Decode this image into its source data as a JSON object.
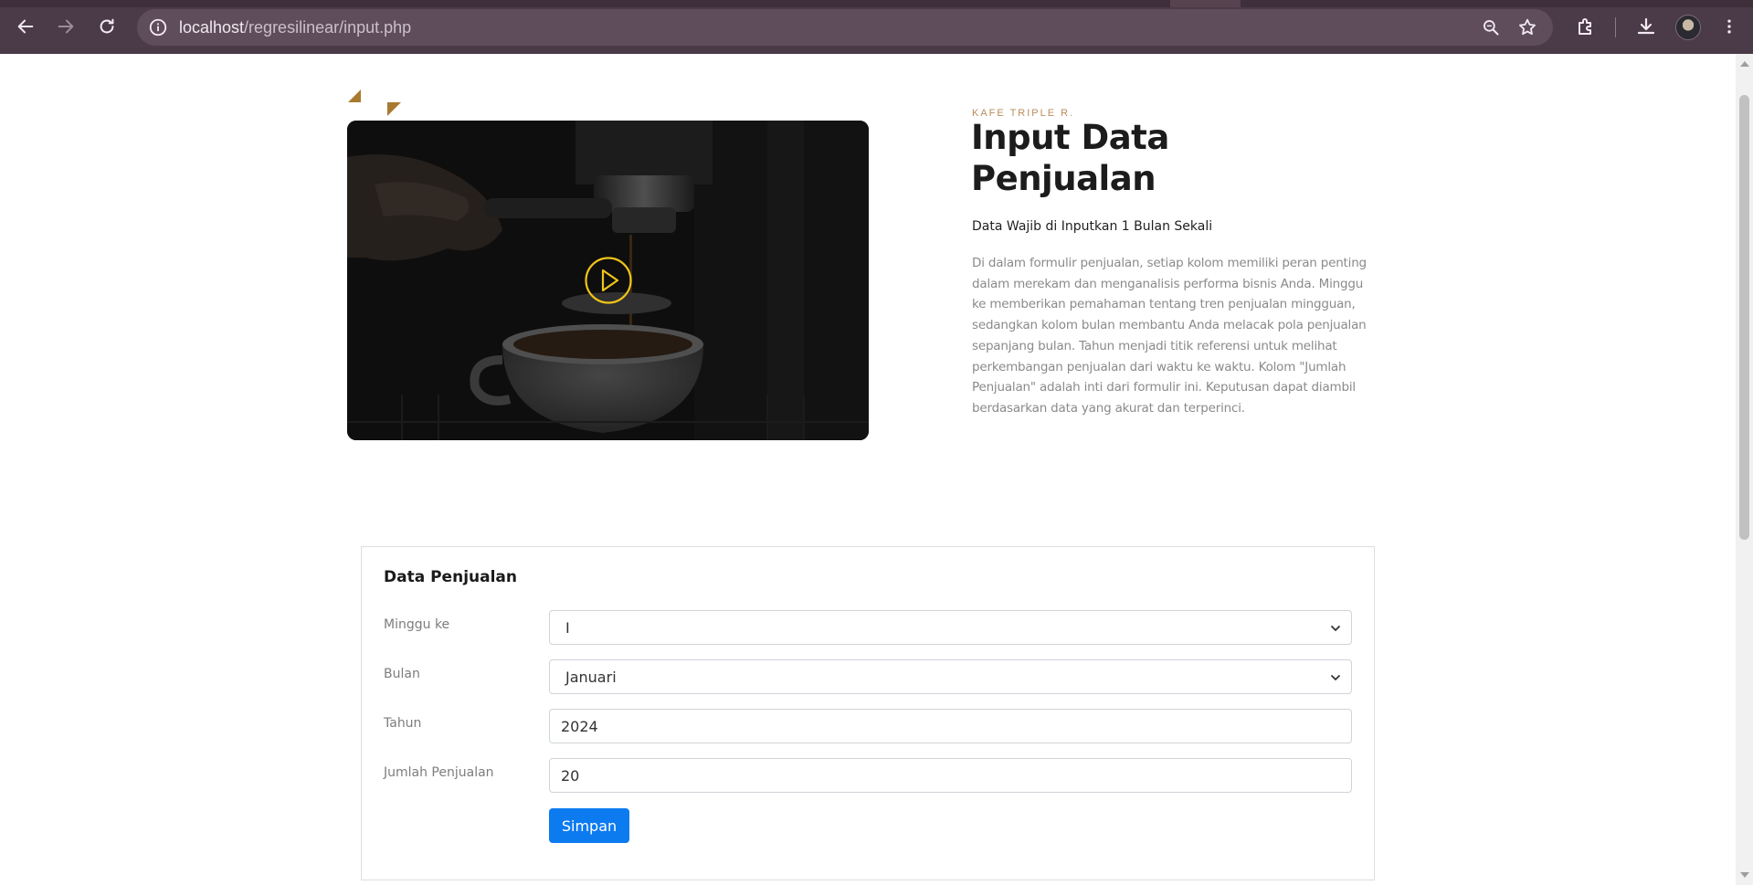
{
  "browser": {
    "url_host": "localhost",
    "url_path": "/regresilinear/input.php"
  },
  "hero": {
    "eyebrow": "KAFE TRIPLE R.",
    "title": "Input Data Penjualan",
    "subtitle": "Data Wajib di Inputkan 1 Bulan Sekali",
    "description": "Di dalam formulir penjualan, setiap kolom memiliki peran penting dalam merekam dan menganalisis performa bisnis Anda. Minggu ke memberikan pemahaman tentang tren penjualan mingguan, sedangkan kolom bulan membantu Anda melacak pola penjualan sepanjang bulan. Tahun menjadi titik referensi untuk melihat perkembangan penjualan dari waktu ke waktu. Kolom \"Jumlah Penjualan\" adalah inti dari formulir ini. Keputusan dapat diambil berdasarkan data yang akurat dan terperinci.",
    "accent_color": "#a87a30",
    "play_icon_color": "#f0c419"
  },
  "form": {
    "title": "Data Penjualan",
    "fields": {
      "minggu": {
        "label": "Minggu ke",
        "value": "I"
      },
      "bulan": {
        "label": "Bulan",
        "value": "Januari"
      },
      "tahun": {
        "label": "Tahun",
        "value": "2024"
      },
      "jumlah": {
        "label": "Jumlah Penjualan",
        "value": "20"
      }
    },
    "submit_label": "Simpan",
    "submit_color": "#0d7bf0"
  }
}
